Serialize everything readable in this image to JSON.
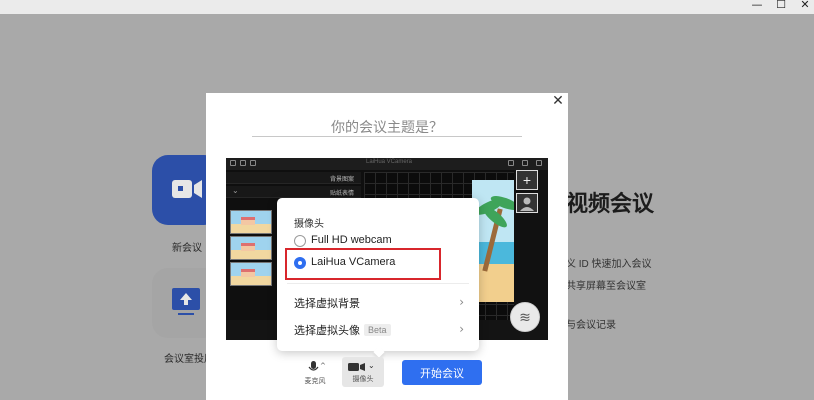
{
  "window": {
    "minimize": "—",
    "maximize": "☐",
    "close": "✕"
  },
  "home": {
    "new_meeting_label": "新会议",
    "share_label": "会议室投屏",
    "title_partial": "视频会议",
    "lines": [
      "义 ID 快速加入会议",
      "共享屏幕至会议室",
      "与会议记录"
    ]
  },
  "modal": {
    "close_icon": "close-icon",
    "topic_placeholder": "你的会议主题是？"
  },
  "preview": {
    "window_title": "LaiHua VCamera",
    "rows": [
      "背景图案",
      "贴纸表情"
    ],
    "fx_icon": "effects-icon"
  },
  "camera_menu": {
    "section_title": "摄像头",
    "options": [
      {
        "label": "Full HD webcam",
        "selected": false
      },
      {
        "label": "LaiHua VCamera",
        "selected": true
      }
    ],
    "items": [
      {
        "label": "选择虚拟背景",
        "badge": ""
      },
      {
        "label": "选择虚拟头像",
        "badge": "Beta"
      }
    ]
  },
  "controls": {
    "mic_label": "麦克风",
    "camera_label": "摄像头",
    "start_button": "开始会议"
  },
  "colors": {
    "accent": "#2f6ff0",
    "highlight": "#d8262c",
    "tile_blue": "#2c4fa8"
  }
}
